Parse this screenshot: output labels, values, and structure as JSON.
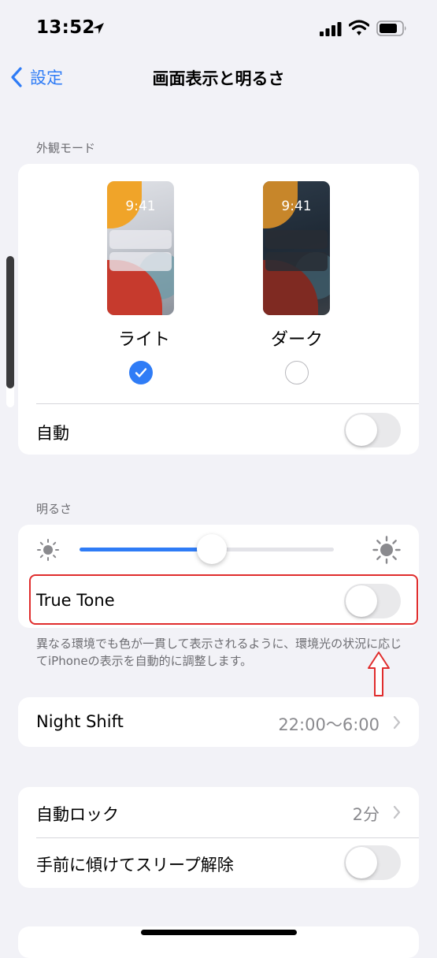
{
  "status_bar": {
    "time": "13:52"
  },
  "nav": {
    "back_label": "設定",
    "title": "画面表示と明るさ"
  },
  "appearance": {
    "header": "外観モード",
    "options": [
      {
        "label": "ライト",
        "preview_time": "9:41",
        "selected": true
      },
      {
        "label": "ダーク",
        "preview_time": "9:41",
        "selected": false
      }
    ],
    "auto_label": "自動",
    "auto_on": false
  },
  "brightness": {
    "header": "明るさ",
    "level": 0.52,
    "true_tone_label": "True Tone",
    "true_tone_on": false,
    "footnote": "異なる環境でも色が一貫して表示されるように、環境光の状況に応じてiPhoneの表示を自動的に調整します。"
  },
  "night_shift": {
    "label": "Night Shift",
    "value": "22:00～6:00"
  },
  "lock": {
    "auto_lock_label": "自動ロック",
    "auto_lock_value": "2分",
    "raise_to_wake_label": "手前に傾けてスリープ解除",
    "raise_to_wake_on": false
  },
  "colors": {
    "accent": "#2f7cf6",
    "highlight": "#e02d2d",
    "background": "#f2f2f7"
  }
}
